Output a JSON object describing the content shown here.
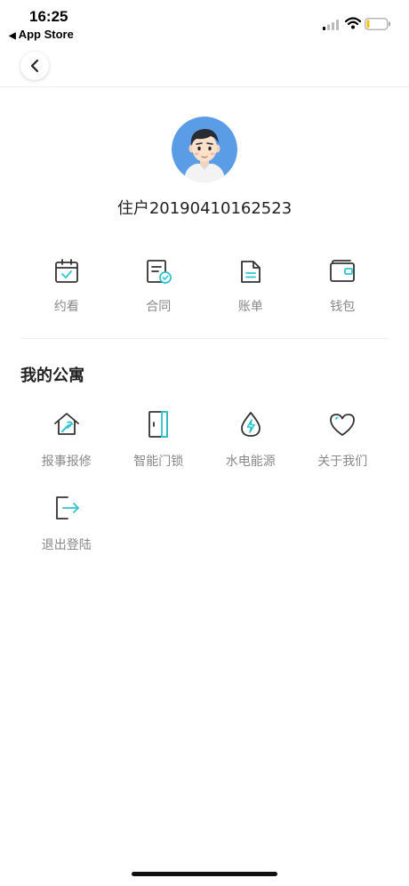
{
  "status_bar": {
    "time": "16:25",
    "back_app": "App Store"
  },
  "profile": {
    "username": "住户20190410162523"
  },
  "quick_actions": [
    {
      "label": "约看",
      "icon": "calendar-check-icon"
    },
    {
      "label": "合同",
      "icon": "contract-check-icon"
    },
    {
      "label": "账单",
      "icon": "bill-document-icon"
    },
    {
      "label": "钱包",
      "icon": "wallet-icon"
    }
  ],
  "apartment": {
    "title": "我的公寓",
    "items": [
      {
        "label": "报事报修",
        "icon": "house-wrench-icon"
      },
      {
        "label": "智能门锁",
        "icon": "door-lock-icon"
      },
      {
        "label": "水电能源",
        "icon": "water-energy-icon"
      },
      {
        "label": "关于我们",
        "icon": "heart-icon"
      },
      {
        "label": "退出登陆",
        "icon": "logout-icon"
      }
    ]
  },
  "colors": {
    "accent": "#2ec5ce",
    "icon_stroke": "#333333",
    "label_gray": "#888888",
    "avatar_bg": "#5a9de6"
  }
}
